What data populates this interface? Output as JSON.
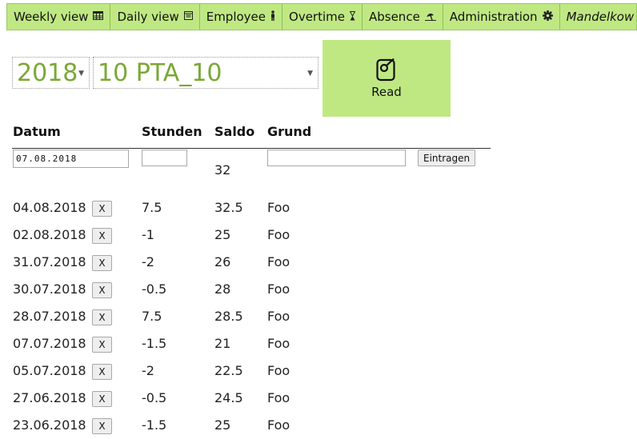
{
  "nav": {
    "items": [
      {
        "label": "Weekly view",
        "icon": "calendar-grid-icon"
      },
      {
        "label": "Daily view",
        "icon": "calendar-day-icon"
      },
      {
        "label": "Employee",
        "icon": "person-icon"
      },
      {
        "label": "Overtime",
        "icon": "hourglass-icon"
      },
      {
        "label": "Absence",
        "icon": "beach-icon"
      },
      {
        "label": "Administration",
        "icon": "gear-icon"
      }
    ],
    "user": {
      "label": "Mandelkow",
      "icon": "user-icon"
    }
  },
  "selectors": {
    "year": "2018",
    "pta": "10 PTA_10"
  },
  "read_button": {
    "label": "Read",
    "icon": "read-icon"
  },
  "colors": {
    "accent": "#bfe883",
    "select_text": "#7aa834"
  },
  "table": {
    "headers": {
      "date": "Datum",
      "hours": "Stunden",
      "saldo": "Saldo",
      "reason": "Grund"
    },
    "entry": {
      "date_value": "07.08.2018",
      "hours_value": "",
      "reason_value": "",
      "submit_label": "Eintragen",
      "current_saldo": "32"
    },
    "delete_label": "X",
    "rows": [
      {
        "date": "04.08.2018",
        "hours": "7.5",
        "saldo": "32.5",
        "reason": "Foo"
      },
      {
        "date": "02.08.2018",
        "hours": "-1",
        "saldo": "25",
        "reason": "Foo"
      },
      {
        "date": "31.07.2018",
        "hours": "-2",
        "saldo": "26",
        "reason": "Foo"
      },
      {
        "date": "30.07.2018",
        "hours": "-0.5",
        "saldo": "28",
        "reason": "Foo"
      },
      {
        "date": "28.07.2018",
        "hours": "7.5",
        "saldo": "28.5",
        "reason": "Foo"
      },
      {
        "date": "07.07.2018",
        "hours": "-1.5",
        "saldo": "21",
        "reason": "Foo"
      },
      {
        "date": "05.07.2018",
        "hours": "-2",
        "saldo": "22.5",
        "reason": "Foo"
      },
      {
        "date": "27.06.2018",
        "hours": "-0.5",
        "saldo": "24.5",
        "reason": "Foo"
      },
      {
        "date": "23.06.2018",
        "hours": "-1.5",
        "saldo": "25",
        "reason": "Foo"
      }
    ]
  }
}
